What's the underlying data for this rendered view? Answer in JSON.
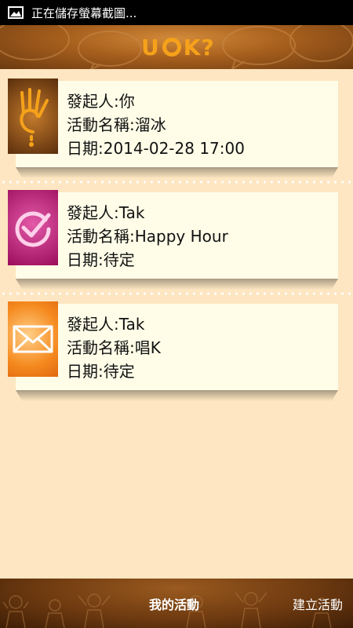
{
  "status_bar": {
    "icon": "image-icon",
    "text": "正在儲存螢幕截圖..."
  },
  "header": {
    "logo_prefix": "U",
    "logo_suffix": "K?"
  },
  "events": [
    {
      "icon": "ok-hand-icon",
      "initiator": "發起人:你",
      "name": "活動名稱:溜冰",
      "date": "日期:2014-02-28 17:00"
    },
    {
      "icon": "check-circle-icon",
      "initiator": "發起人:Tak",
      "name": "活動名稱:Happy Hour",
      "date": "日期:待定"
    },
    {
      "icon": "envelope-icon",
      "initiator": "發起人:Tak",
      "name": "活動名稱:唱K",
      "date": "日期:待定"
    }
  ],
  "tabs": {
    "my_events": "我的活動",
    "create_event": "建立活動"
  },
  "colors": {
    "background": "#fde6c1",
    "card": "#fffde8",
    "logo": "#f5a21a",
    "header": "#a75f1d"
  }
}
